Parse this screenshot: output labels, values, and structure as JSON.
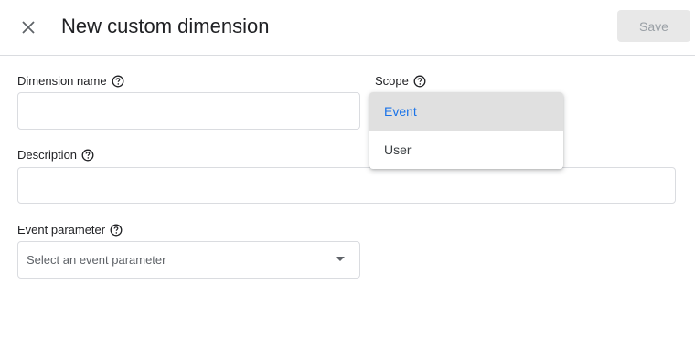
{
  "header": {
    "title": "New custom dimension",
    "save_label": "Save"
  },
  "form": {
    "dimension_name": {
      "label": "Dimension name",
      "value": ""
    },
    "scope": {
      "label": "Scope",
      "options": [
        "Event",
        "User"
      ],
      "selected": "Event"
    },
    "description": {
      "label": "Description",
      "value": ""
    },
    "event_parameter": {
      "label": "Event parameter",
      "placeholder": "Select an event parameter"
    }
  },
  "colors": {
    "accent": "#1a73e8",
    "border": "#dadce0",
    "save_disabled_bg": "#e8e8e8",
    "save_disabled_text": "#9aa0a6",
    "selected_item_bg": "#e0e0e0"
  }
}
